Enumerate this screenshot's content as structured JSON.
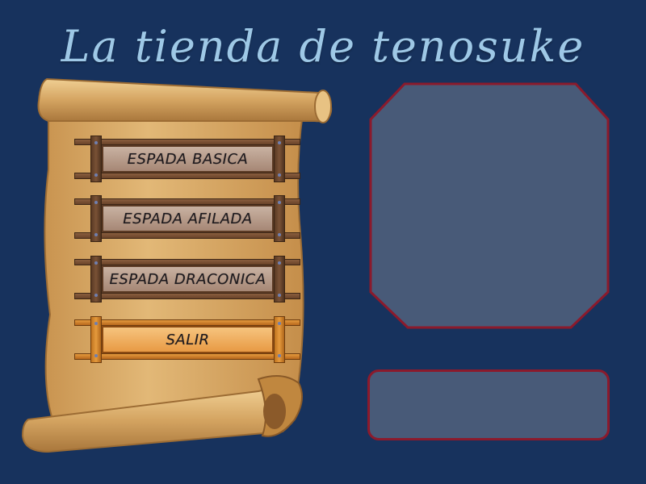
{
  "title": "La tienda de tenosuke",
  "menu": {
    "items": [
      {
        "label": "ESPADA BASICA",
        "active": false
      },
      {
        "label": "ESPADA AFILADA",
        "active": false
      },
      {
        "label": "ESPADA DRACONICA",
        "active": false
      },
      {
        "label": "SALIR",
        "active": true
      }
    ]
  },
  "colors": {
    "background": "#17325d",
    "title": "#9ec8e6",
    "panel_fill": "#485a78",
    "panel_border": "#8b1a2c",
    "parchment": "#d9ac6a",
    "wood": "#6a4329",
    "active_wood": "#e59a3d"
  },
  "icons": {
    "scroll": "parchment-scroll-icon"
  }
}
